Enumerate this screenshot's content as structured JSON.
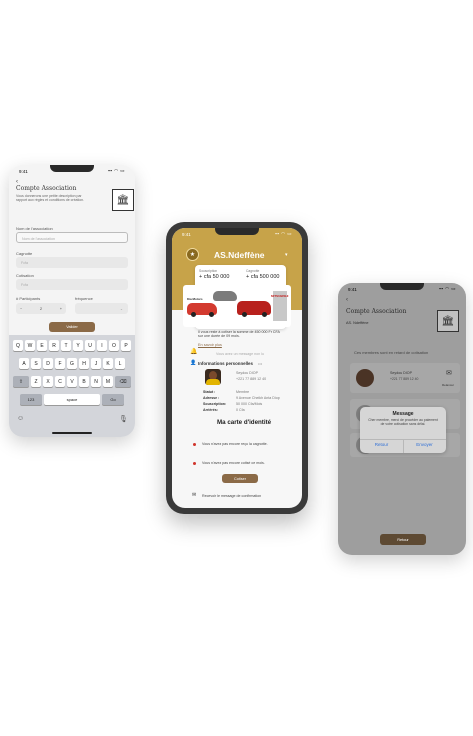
{
  "left_phone": {
    "status_time": "9:41",
    "title": "Compte Association",
    "description": "Vous donnerons une petite description par rapport aux règles et conditions de création.",
    "name_label": "Nom de l'association",
    "name_placeholder": "Nom de l'association",
    "cagnotte_label": "Cagnotte",
    "cagnotte_placeholder": "Fcfa",
    "cotisation_label": "Cotisation",
    "cotisation_placeholder": "Fcfa",
    "participants_label": "# Participants",
    "frequence_label": "fréquence",
    "participants_value": "2",
    "validate_label": "Valider",
    "keyboard": {
      "row1": [
        "Q",
        "W",
        "E",
        "R",
        "T",
        "Y",
        "U",
        "I",
        "O",
        "P"
      ],
      "row2": [
        "A",
        "S",
        "D",
        "F",
        "G",
        "H",
        "J",
        "K",
        "L"
      ],
      "row3": [
        "Z",
        "X",
        "C",
        "V",
        "B",
        "N",
        "M"
      ],
      "num_key": "123",
      "space_key": "space",
      "go_key": "Go"
    }
  },
  "middle_phone": {
    "status_time": "9:41",
    "association_name": "AS.Ndeffène",
    "souscription_label": "Souscription",
    "souscription_value": "+ cfa 50 000",
    "cagnotte_label": "Cagnotte",
    "cagnotte_value": "+ cfa 500 000",
    "ad_tag_1": "Kia Motors",
    "ad_tag_2": "MITSUBISHI",
    "reminder_text": "Il vous reste à cotiser la somme de 450 000 Fr CFA sur une durée de 09 mois.",
    "see_more": "En savoir plus",
    "notification_text": "Vous avez un message non lu",
    "personal_info_title": "Informations personnelles",
    "member_name": "Seydou DIOP",
    "member_phone": "+221 77 889 12 40",
    "statut_label": "Statut :",
    "statut_value": "Membre",
    "adresse_label": "Adresse :",
    "adresse_value": "9 Avenue Cheikh Anta Diop",
    "souscription_row_label": "Souscription:",
    "souscription_row_value": "50 000 Cfa/Mois",
    "arrieres_label": "Arriérés:",
    "arrieres_value": "0 Cfa",
    "id_card_title": "Ma carte d'identité",
    "alert_1": "Vous n'avez pas encore reçu la cagnotte.",
    "alert_2": "Vous n'avez pas encore cotisé ce mois.",
    "cotiser_label": "Cotiser",
    "footer_text": "Recevoir le message de confirmation"
  },
  "right_phone": {
    "status_time": "9:41",
    "title": "Compte Association",
    "subtitle": "AS. Ndeffène",
    "hint": "Ces membres sont en retard de cotisation",
    "member_name": "Seydou DIOP",
    "member_phone": "+221 77 889 12 40",
    "relancer_label": "Relancer",
    "retour_label": "Retour",
    "dialog": {
      "title": "Message",
      "message": "Cher membre, merci de procéder au paiement de votre cotisation sans délai.",
      "cancel": "Retour",
      "confirm": "Envoyer"
    }
  },
  "colors": {
    "gold": "#c7a349",
    "brown": "#8b6a47",
    "alert_red": "#d0352c",
    "link_blue": "#2f6fd6"
  }
}
